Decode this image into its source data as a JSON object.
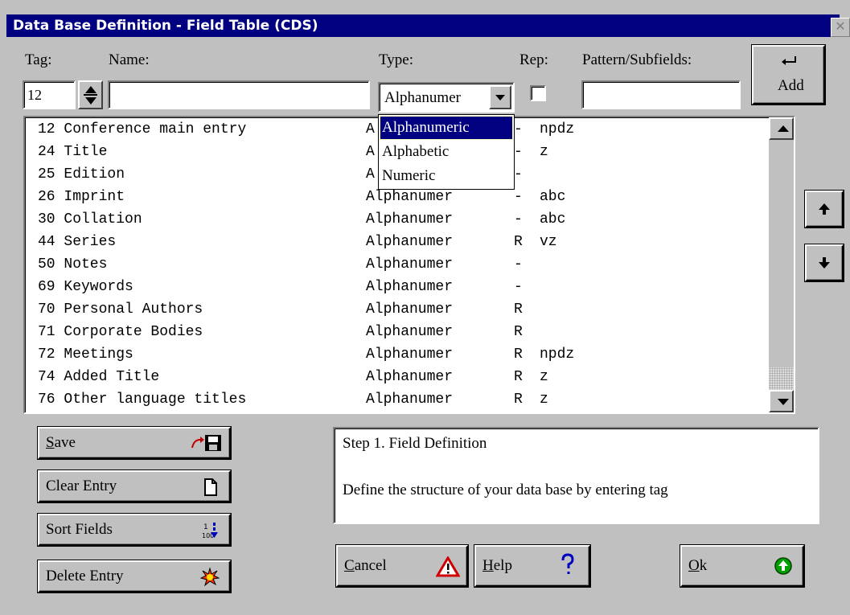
{
  "window": {
    "title": "Data Base Definition - Field Table (CDS)",
    "close_label": "✕",
    "titlebar_color": "#000080"
  },
  "form": {
    "tag_label": "Tag:",
    "name_label": "Name:",
    "type_label": "Type:",
    "rep_label": "Rep:",
    "pattern_label": "Pattern/Subfields:",
    "tag_value": "12",
    "name_value": "",
    "type_value": "Alphanumer",
    "rep_checked": false,
    "pattern_value": ""
  },
  "add_button": {
    "label": "Add",
    "icon": "enter-arrow-icon"
  },
  "type_dropdown": {
    "options": [
      "Alphanumeric",
      "Alphabetic",
      "Numeric"
    ],
    "selected_index": 0
  },
  "fields": [
    {
      "name": "12 Conference main entry",
      "type": "A",
      "rep": "-",
      "pattern": "npdz"
    },
    {
      "name": "24 Title",
      "type": "A",
      "rep": "-",
      "pattern": "z"
    },
    {
      "name": "25 Edition",
      "type": "A",
      "rep": "-",
      "pattern": ""
    },
    {
      "name": "26 Imprint",
      "type": "Alphanumer",
      "rep": "-",
      "pattern": "abc"
    },
    {
      "name": "30 Collation",
      "type": "Alphanumer",
      "rep": "-",
      "pattern": "abc"
    },
    {
      "name": "44 Series",
      "type": "Alphanumer",
      "rep": "R",
      "pattern": "vz"
    },
    {
      "name": "50 Notes",
      "type": "Alphanumer",
      "rep": "-",
      "pattern": ""
    },
    {
      "name": "69 Keywords",
      "type": "Alphanumer",
      "rep": "-",
      "pattern": ""
    },
    {
      "name": "70 Personal Authors",
      "type": "Alphanumer",
      "rep": "R",
      "pattern": ""
    },
    {
      "name": "71 Corporate Bodies",
      "type": "Alphanumer",
      "rep": "R",
      "pattern": ""
    },
    {
      "name": "72 Meetings",
      "type": "Alphanumer",
      "rep": "R",
      "pattern": "npdz"
    },
    {
      "name": "74 Added Title",
      "type": "Alphanumer",
      "rep": "R",
      "pattern": "z"
    },
    {
      "name": "76 Other language titles",
      "type": "Alphanumer",
      "rep": "R",
      "pattern": "z"
    }
  ],
  "buttons": {
    "save": {
      "mnemonic": "S",
      "rest": "ave",
      "icon": "save-disk-icon"
    },
    "clear": {
      "label": "Clear Entry",
      "icon": "blank-page-icon"
    },
    "sort": {
      "label": "Sort Fields",
      "icon": "sort-icon"
    },
    "delete": {
      "label": "Delete Entry",
      "icon": "explosion-icon"
    },
    "cancel": {
      "mnemonic": "C",
      "rest": "ancel",
      "icon": "warning-triangle-icon"
    },
    "help": {
      "mnemonic": "H",
      "rest": "elp",
      "icon": "question-mark-icon"
    },
    "ok": {
      "mnemonic": "O",
      "rest": "k",
      "icon": "green-up-arrow-icon"
    },
    "move_up_icon": "up-arrow-icon",
    "move_down_icon": "down-arrow-icon"
  },
  "info": {
    "heading": "Step 1. Field Definition",
    "text": "Define the structure of your data base by entering tag"
  }
}
